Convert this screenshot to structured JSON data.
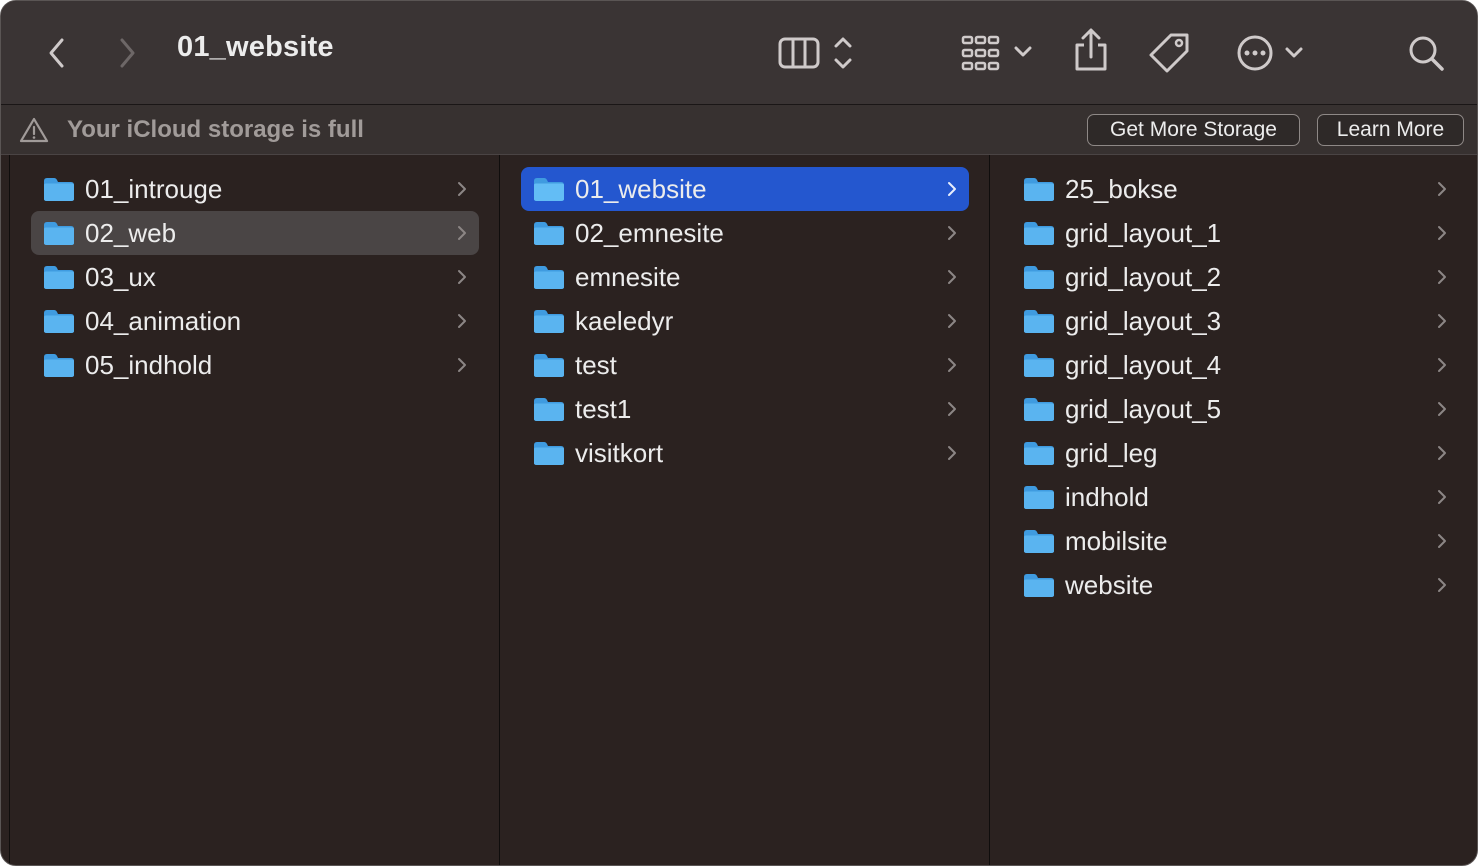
{
  "window": {
    "title": "01_website"
  },
  "toolbar": {
    "back_icon": "chevron-left-icon",
    "forward_icon": "chevron-right-icon",
    "view_icon": "column-view-icon",
    "group_icon": "grid-group-icon",
    "share_icon": "share-icon",
    "tag_icon": "tag-icon",
    "more_icon": "ellipsis-circle-icon",
    "search_icon": "search-icon"
  },
  "banner": {
    "message": "Your iCloud storage is full",
    "get_more_label": "Get More Storage",
    "learn_more_label": "Learn More"
  },
  "columns": [
    {
      "items": [
        {
          "label": "01_introuge",
          "state": "normal"
        },
        {
          "label": "02_web",
          "state": "hover"
        },
        {
          "label": "03_ux",
          "state": "normal"
        },
        {
          "label": "04_animation",
          "state": "normal"
        },
        {
          "label": "05_indhold",
          "state": "normal"
        }
      ]
    },
    {
      "items": [
        {
          "label": "01_website",
          "state": "selected"
        },
        {
          "label": "02_emnesite",
          "state": "normal"
        },
        {
          "label": "emnesite",
          "state": "normal"
        },
        {
          "label": "kaeledyr",
          "state": "normal"
        },
        {
          "label": "test",
          "state": "normal"
        },
        {
          "label": "test1",
          "state": "normal"
        },
        {
          "label": "visitkort",
          "state": "normal"
        }
      ]
    },
    {
      "items": [
        {
          "label": "25_bokse",
          "state": "normal"
        },
        {
          "label": "grid_layout_1",
          "state": "normal"
        },
        {
          "label": "grid_layout_2",
          "state": "normal"
        },
        {
          "label": "grid_layout_3",
          "state": "normal"
        },
        {
          "label": "grid_layout_4",
          "state": "normal"
        },
        {
          "label": "grid_layout_5",
          "state": "normal"
        },
        {
          "label": "grid_leg",
          "state": "normal"
        },
        {
          "label": "indhold",
          "state": "normal"
        },
        {
          "label": "mobilsite",
          "state": "normal"
        },
        {
          "label": "website",
          "state": "normal"
        }
      ]
    }
  ],
  "colors": {
    "window_bg": "#2b2220",
    "toolbar_bg": "#3a3434",
    "selection": "#2457cf",
    "hover": "#4a4545",
    "folder_blue": "#5ab4f0",
    "text": "#ececec"
  }
}
